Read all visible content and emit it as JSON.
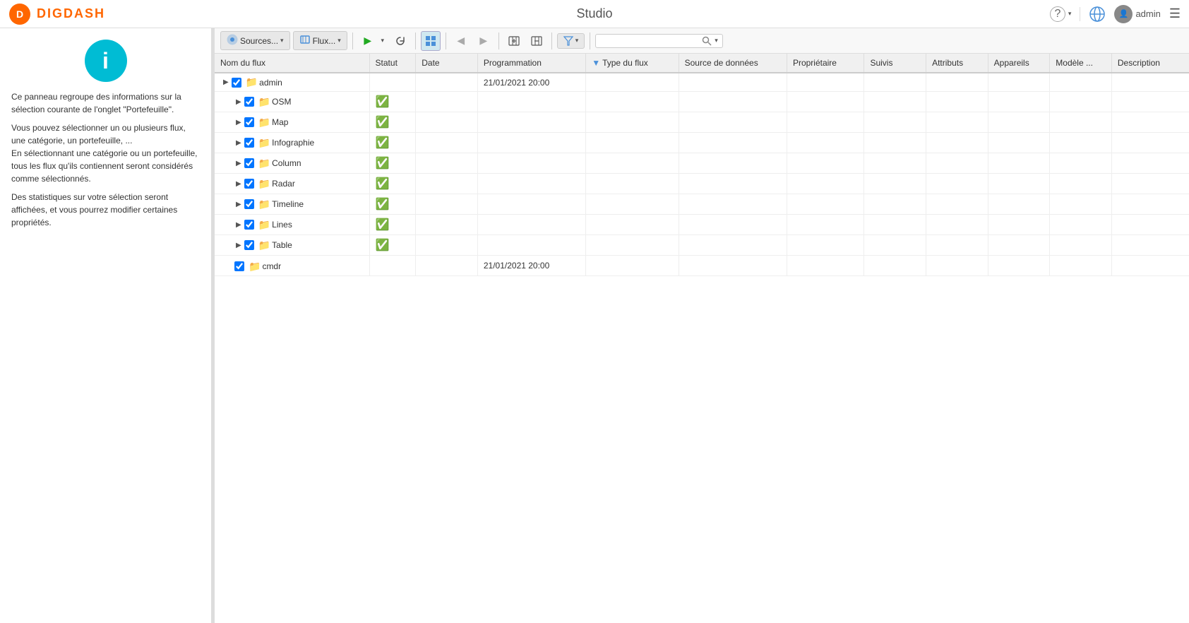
{
  "app": {
    "title": "Studio",
    "logo_text": "DIGDASH"
  },
  "topbar": {
    "help_label": "?",
    "user_label": "admin",
    "menu_label": "☰"
  },
  "toolbar": {
    "sources_label": "Sources...",
    "flux_label": "Flux...",
    "search_placeholder": ""
  },
  "columns": [
    {
      "key": "nom_du_flux",
      "label": "Nom du flux"
    },
    {
      "key": "statut",
      "label": "Statut"
    },
    {
      "key": "date",
      "label": "Date"
    },
    {
      "key": "programmation",
      "label": "Programmation"
    },
    {
      "key": "type_du_flux",
      "label": "Type du flux"
    },
    {
      "key": "source_de_donnees",
      "label": "Source de données"
    },
    {
      "key": "proprietaire",
      "label": "Propriétaire"
    },
    {
      "key": "suivis",
      "label": "Suivis"
    },
    {
      "key": "attributs",
      "label": "Attributs"
    },
    {
      "key": "appareils",
      "label": "Appareils"
    },
    {
      "key": "modele",
      "label": "Modèle ..."
    },
    {
      "key": "description",
      "label": "Description"
    }
  ],
  "rows": [
    {
      "id": "admin",
      "level": 0,
      "name": "admin",
      "expand": true,
      "checked": true,
      "status": "",
      "date": "",
      "programmation": "21/01/2021 20:00",
      "icon": "folder-blue",
      "type": "category"
    },
    {
      "id": "osm",
      "level": 1,
      "name": "OSM",
      "expand": true,
      "checked": true,
      "status": "ok",
      "date": "",
      "programmation": "",
      "icon": "folder",
      "type": "category"
    },
    {
      "id": "map",
      "level": 1,
      "name": "Map",
      "expand": true,
      "checked": true,
      "status": "ok",
      "date": "",
      "programmation": "",
      "icon": "folder",
      "type": "category"
    },
    {
      "id": "infographie",
      "level": 1,
      "name": "Infographie",
      "expand": true,
      "checked": true,
      "status": "ok",
      "date": "",
      "programmation": "",
      "icon": "folder",
      "type": "category"
    },
    {
      "id": "column",
      "level": 1,
      "name": "Column",
      "expand": true,
      "checked": true,
      "status": "ok",
      "date": "",
      "programmation": "",
      "icon": "folder",
      "type": "category"
    },
    {
      "id": "radar",
      "level": 1,
      "name": "Radar",
      "expand": true,
      "checked": true,
      "status": "ok",
      "date": "",
      "programmation": "",
      "icon": "folder",
      "type": "category"
    },
    {
      "id": "timeline",
      "level": 1,
      "name": "Timeline",
      "expand": true,
      "checked": true,
      "status": "ok",
      "date": "",
      "programmation": "",
      "icon": "folder",
      "type": "category"
    },
    {
      "id": "lines",
      "level": 1,
      "name": "Lines",
      "expand": true,
      "checked": true,
      "status": "ok",
      "date": "",
      "programmation": "",
      "icon": "folder",
      "type": "category"
    },
    {
      "id": "table",
      "level": 1,
      "name": "Table",
      "expand": true,
      "checked": true,
      "status": "ok",
      "date": "",
      "programmation": "",
      "icon": "folder",
      "type": "category"
    },
    {
      "id": "cmdr",
      "level": 0,
      "name": "cmdr",
      "expand": false,
      "checked": true,
      "status": "",
      "date": "",
      "programmation": "21/01/2021 20:00",
      "icon": "folder-orange",
      "type": "category"
    }
  ],
  "left_panel": {
    "info_title": "i",
    "paragraphs": [
      "Ce panneau regroupe des informations sur la sélection courante de l'onglet \"Portefeuille\".",
      "Vous pouvez sélectionner un ou plusieurs flux, une catégorie, un portefeuille, ...\nEn sélectionnant une catégorie ou un portefeuille, tous les flux qu'ils contiennent seront considérés comme sélectionnés.",
      "Des statistiques sur votre sélection seront affichées, et vous pourrez modifier certaines propriétés."
    ]
  }
}
